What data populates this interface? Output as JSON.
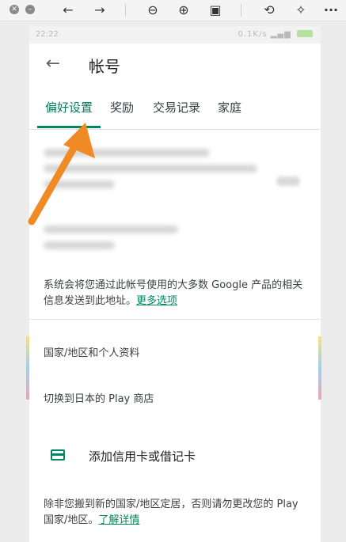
{
  "viewer": {
    "icons": [
      "close-circle-icon",
      "minimize-circle-icon",
      "back-arrow-icon",
      "forward-arrow-icon",
      "zoom-out-icon",
      "zoom-in-icon",
      "fit-screen-icon",
      "rotate-icon",
      "magic-wand-icon",
      "more-icon"
    ]
  },
  "statusbar": {
    "time": "22:22",
    "right": "0.1K/s"
  },
  "appbar": {
    "title": "帐号"
  },
  "tabs": [
    {
      "label": "偏好设置",
      "active": true
    },
    {
      "label": "奖励",
      "active": false
    },
    {
      "label": "交易记录",
      "active": false
    },
    {
      "label": "家庭",
      "active": false
    }
  ],
  "info": {
    "text": "系统会将您通过此帐号使用的大多数 Google 产品的相关信息发送到此地址。",
    "link": "更多选项"
  },
  "sections": {
    "country_profile": "国家/地区和个人资料",
    "switch_store": "切换到日本的 Play 商店",
    "add_card": "添加信用卡或借记卡"
  },
  "footer": {
    "text": "除非您搬到新的国家/地区定居，否则请勿更改您的 Play 国家/地区。",
    "link": "了解详情"
  },
  "colors": {
    "accent": "#01875f",
    "annotation_arrow": "#f08a24"
  }
}
